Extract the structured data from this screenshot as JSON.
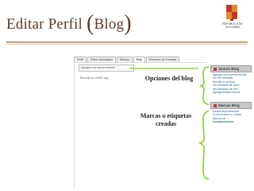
{
  "title": {
    "main": "Editar Perfil",
    "paren_open": "(",
    "blog": "Blog",
    "paren_close": ")"
  },
  "logo": {
    "line1": "REPÚBLICA DE",
    "line2": "COLOMBIA",
    "colors": {
      "primary": "#c0392b",
      "secondary": "#e08a2e"
    }
  },
  "blog_ui": {
    "tabs": [
      {
        "label": "Perfil"
      },
      {
        "label": "Editar información"
      },
      {
        "label": "Mensaj"
      },
      {
        "label": "Blog",
        "active": true
      },
      {
        "label": "Directorio de Entradas"
      }
    ],
    "subscribe_label": "Agregar una nueva entrada",
    "time_ago": "Entrada no visible ago"
  },
  "annotations": {
    "options": "Opciones del blog",
    "tags_line1": "Marcas o etiquetas",
    "tags_line2": "creadas"
  },
  "sidebar": {
    "search_header": "Search Blog",
    "links": [
      "Agregar una nueva entrada",
      "Ver las entradas",
      "Escribir en el blog",
      "Ver entradas de otros",
      "Ver entradas de otro",
      "Agregar/editar marcas"
    ],
    "tags_header": "Marcas Blog",
    "tags": [
      "Desarrolloprofesional",
      "Comunicación y Lineas",
      "Marcos de",
      "Construcciones"
    ]
  }
}
